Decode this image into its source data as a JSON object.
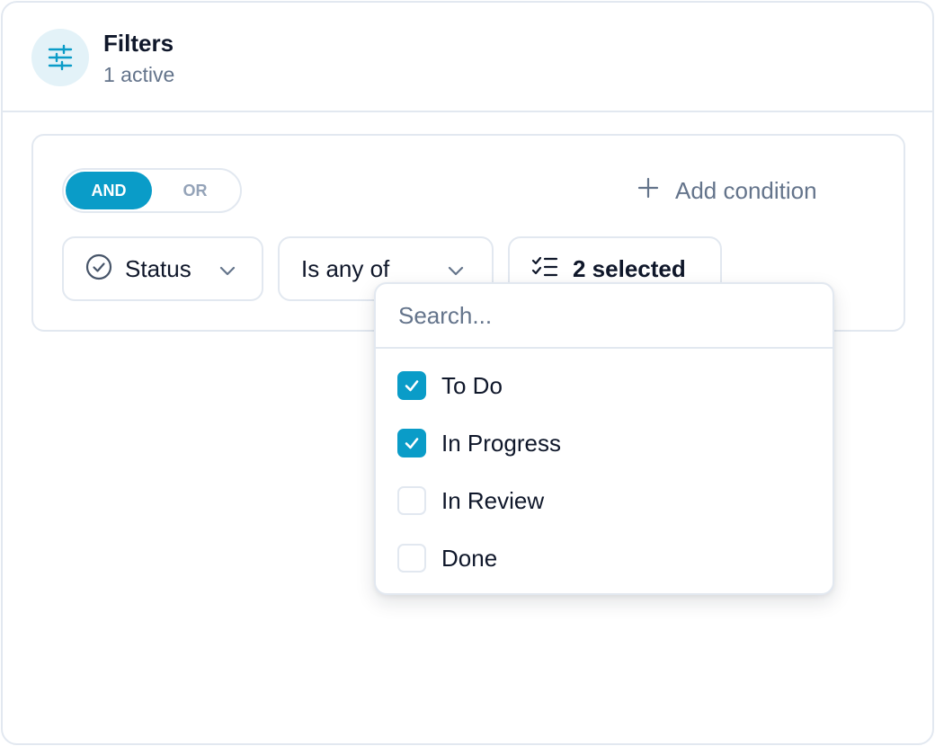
{
  "header": {
    "title": "Filters",
    "subtitle": "1 active"
  },
  "logic": {
    "options": [
      "AND",
      "OR"
    ],
    "selected": "AND"
  },
  "add_condition_label": "Add condition",
  "condition": {
    "field": "Status",
    "operator": "Is any of",
    "value_summary": "2 selected"
  },
  "dropdown": {
    "search_placeholder": "Search...",
    "options": [
      {
        "label": "To Do",
        "checked": true
      },
      {
        "label": "In Progress",
        "checked": true
      },
      {
        "label": "In Review",
        "checked": false
      },
      {
        "label": "Done",
        "checked": false
      }
    ]
  },
  "colors": {
    "accent": "#0a9cc8",
    "accent_soft": "#e3f2f8",
    "border": "#e2e8f0",
    "muted_text": "#64748b",
    "text": "#0f172a"
  },
  "icons": {
    "header": "sliders-icon",
    "add": "plus-icon",
    "field": "check-circle-icon",
    "chevron": "chevron-down-icon",
    "value": "checklist-icon",
    "checkbox_mark": "check-icon"
  }
}
